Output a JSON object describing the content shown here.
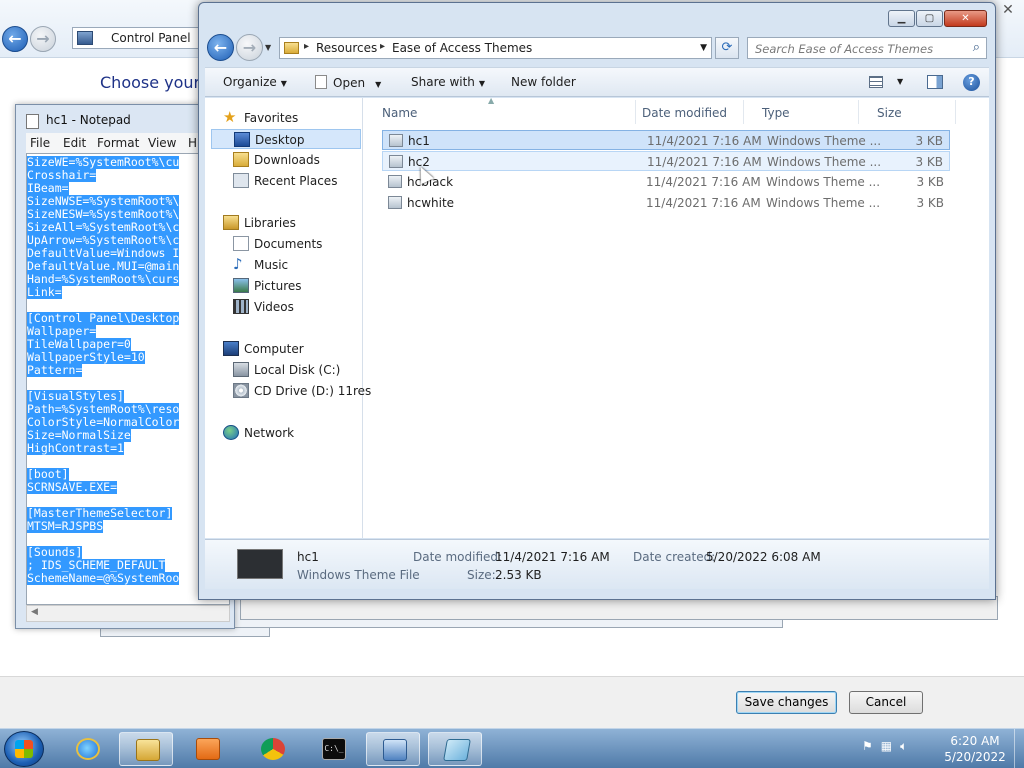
{
  "control_panel": {
    "address": "Control Panel",
    "heading": "Choose your c",
    "save_label": "Save changes",
    "cancel_label": "Cancel"
  },
  "notepad": {
    "title": "hc1 - Notepad",
    "menu": [
      "File",
      "Edit",
      "Format",
      "View",
      "H"
    ],
    "lines": [
      "SizeWE=%SystemRoot%\\cu",
      "Crosshair=",
      "IBeam=",
      "SizeNWSE=%SystemRoot%\\",
      "SizeNESW=%SystemRoot%\\",
      "SizeAll=%SystemRoot%\\c",
      "UpArrow=%SystemRoot%\\c",
      "DefaultValue=Windows I",
      "DefaultValue.MUI=@main",
      "Hand=%SystemRoot%\\curs",
      "Link=",
      "",
      "[Control Panel\\Desktop",
      "Wallpaper=",
      "TileWallpaper=0",
      "WallpaperStyle=10",
      "Pattern=",
      "",
      "[VisualStyles]",
      "Path=%SystemRoot%\\reso",
      "ColorStyle=NormalColor",
      "Size=NormalSize",
      "HighContrast=1",
      "",
      "[boot]",
      "SCRNSAVE.EXE=",
      "",
      "[MasterThemeSelector]",
      "MTSM=RJSPBS",
      "",
      "[Sounds]",
      "; IDS_SCHEME_DEFAULT",
      "SchemeName=@%SystemRoo"
    ]
  },
  "dialog": {
    "breadcrumb": [
      "Resources",
      "Ease of Access Themes"
    ],
    "search_placeholder": "Search Ease of Access Themes",
    "toolbar": {
      "organize": "Organize",
      "open": "Open",
      "share": "Share with",
      "new_folder": "New folder"
    },
    "nav": {
      "favorites": "Favorites",
      "desktop": "Desktop",
      "downloads": "Downloads",
      "recent": "Recent Places",
      "libraries": "Libraries",
      "documents": "Documents",
      "music": "Music",
      "pictures": "Pictures",
      "videos": "Videos",
      "computer": "Computer",
      "local_disk": "Local Disk (C:)",
      "cd_drive": "CD Drive (D:) 11res",
      "network": "Network"
    },
    "columns": {
      "name": "Name",
      "date": "Date modified",
      "type": "Type",
      "size": "Size"
    },
    "files": [
      {
        "name": "hc1",
        "date": "11/4/2021 7:16 AM",
        "type": "Windows Theme ...",
        "size": "3 KB"
      },
      {
        "name": "hc2",
        "date": "11/4/2021 7:16 AM",
        "type": "Windows Theme ...",
        "size": "3 KB"
      },
      {
        "name": "hcblack",
        "date": "11/4/2021 7:16 AM",
        "type": "Windows Theme ...",
        "size": "3 KB"
      },
      {
        "name": "hcwhite",
        "date": "11/4/2021 7:16 AM",
        "type": "Windows Theme ...",
        "size": "3 KB"
      }
    ],
    "details": {
      "name": "hc1",
      "kind": "Windows Theme File",
      "modified_label": "Date modified:",
      "modified_value": "11/4/2021 7:16 AM",
      "created_label": "Date created:",
      "created_value": "5/20/2022 6:08 AM",
      "size_label": "Size:",
      "size_value": "2.53 KB"
    }
  },
  "taskbar": {
    "time": "6:20 AM",
    "date": "5/20/2022",
    "cmd_glyph": "C:\\_"
  }
}
